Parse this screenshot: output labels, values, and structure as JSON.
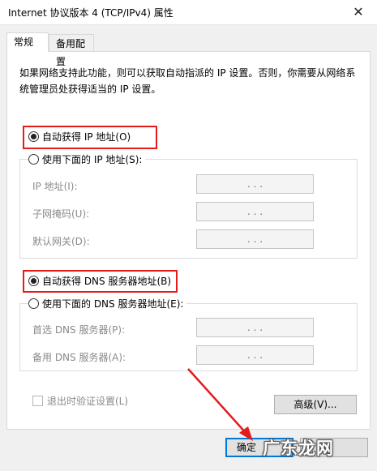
{
  "window": {
    "title": "Internet 协议版本 4 (TCP/IPv4) 属性",
    "close_symbol": "✕"
  },
  "tabs": [
    {
      "label": "常规"
    },
    {
      "label": "备用配置"
    }
  ],
  "description": "如果网络支持此功能，则可以获取自动指派的 IP 设置。否则，你需要从网络系统管理员处获得适当的 IP 设置。",
  "ip_section": {
    "auto_label": "自动获得 IP 地址(O)",
    "manual_label": "使用下面的 IP 地址(S):",
    "auto_selected": true,
    "fields": [
      {
        "label": "IP 地址(I):",
        "value": ".   .   ."
      },
      {
        "label": "子网掩码(U):",
        "value": ".   .   ."
      },
      {
        "label": "默认网关(D):",
        "value": ".   .   ."
      }
    ]
  },
  "dns_section": {
    "auto_label": "自动获得 DNS 服务器地址(B)",
    "manual_label": "使用下面的 DNS 服务器地址(E):",
    "auto_selected": true,
    "fields": [
      {
        "label": "首选 DNS 服务器(P):",
        "value": ".   .   ."
      },
      {
        "label": "备用 DNS 服务器(A):",
        "value": ".   .   ."
      }
    ]
  },
  "validate_checkbox": {
    "label": "退出时验证设置(L)",
    "checked": false
  },
  "buttons": {
    "advanced": "高级(V)...",
    "ok": "确定",
    "cancel": ""
  },
  "watermark": "广东龙网",
  "colors": {
    "highlight": "#e31b1b",
    "focus": "#0078d7"
  }
}
